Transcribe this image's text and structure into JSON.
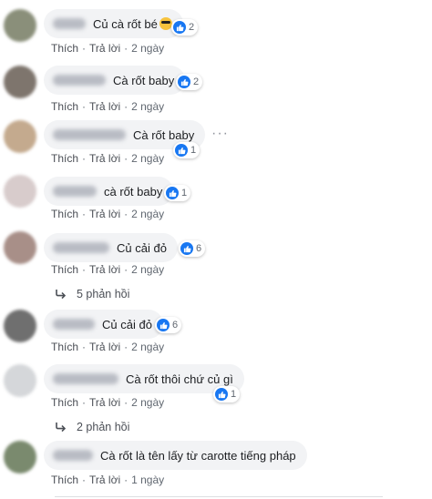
{
  "comments": [
    {
      "text": "Củ cà rốt bé",
      "reactions": "2",
      "like": "Thích",
      "reply": "Trả lời",
      "time": "2 ngày",
      "emoji": "sunglasses-emoji"
    },
    {
      "text": "Cà rốt baby",
      "reactions": "2",
      "like": "Thích",
      "reply": "Trả lời",
      "time": "2 ngày"
    },
    {
      "text": "Cà rốt baby",
      "reactions": "1",
      "like": "Thích",
      "reply": "Trả lời",
      "time": "2 ngày",
      "more": "···"
    },
    {
      "text": "cà rốt baby",
      "reactions": "1",
      "like": "Thích",
      "reply": "Trả lời",
      "time": "2 ngày"
    },
    {
      "text": "Củ cải đỏ",
      "reactions": "6",
      "like": "Thích",
      "reply": "Trả lời",
      "time": "2 ngày"
    },
    {
      "text": "Củ cải đỏ",
      "reactions": "6",
      "like": "Thích",
      "reply": "Trả lời",
      "time": "2 ngày"
    },
    {
      "text": "Cà rốt thôi chứ củ gì",
      "reactions": "1",
      "like": "Thích",
      "reply": "Trả lời",
      "time": "2 ngày"
    },
    {
      "text": "Cà rốt là tên lấy từ carotte tiếng pháp",
      "like": "Thích",
      "reply": "Trả lời",
      "time": "1 ngày"
    }
  ],
  "replies": [
    {
      "label": "5 phản hồi"
    },
    {
      "label": "2 phản hồi"
    }
  ],
  "dot": "·",
  "colors": {
    "like_blue": "#1877f2",
    "bubble_bg": "#f2f3f5",
    "meta_text": "#606770"
  }
}
